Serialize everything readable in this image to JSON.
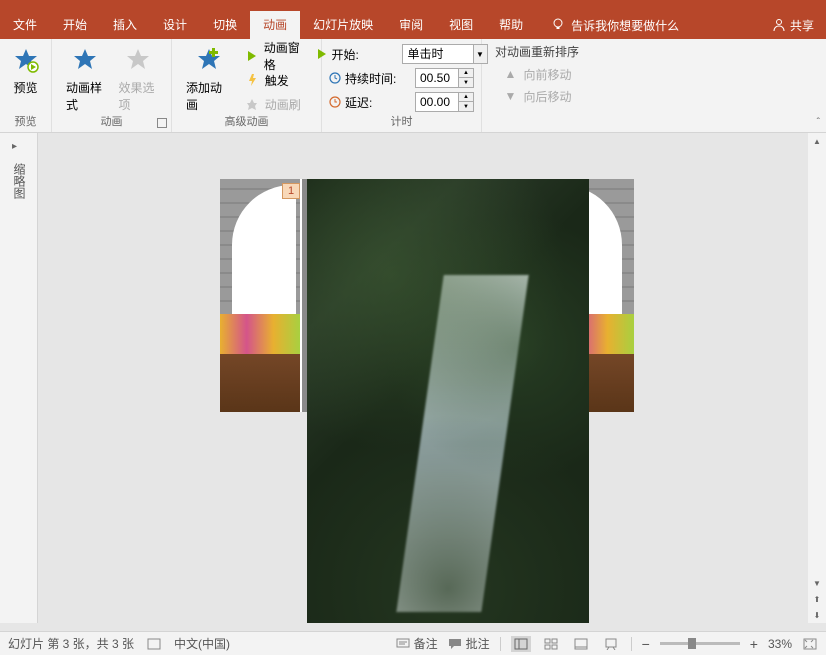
{
  "tabs": {
    "file": "文件",
    "home": "开始",
    "insert": "插入",
    "design": "设计",
    "transitions": "切换",
    "animations": "动画",
    "slideshow": "幻灯片放映",
    "review": "审阅",
    "view": "视图",
    "help": "帮助"
  },
  "tell_me": "告诉我你想要做什么",
  "share": "共享",
  "ribbon": {
    "preview": {
      "btn": "预览",
      "group": "预览"
    },
    "animation": {
      "styles": "动画样式",
      "options": "效果选项",
      "group": "动画"
    },
    "advanced": {
      "add": "添加动画",
      "pane": "动画窗格",
      "trigger": "触发",
      "painter": "动画刷",
      "group": "高级动画"
    },
    "timing": {
      "start_lbl": "开始:",
      "start_val": "单击时",
      "duration_lbl": "持续时间:",
      "duration_val": "00.50",
      "delay_lbl": "延迟:",
      "delay_val": "00.00",
      "group": "计时"
    },
    "reorder": {
      "title": "对动画重新排序",
      "earlier": "向前移动",
      "later": "向后移动"
    }
  },
  "panel_label": "缩略图",
  "anim_tag": "1",
  "status": {
    "slide": "幻灯片 第 3 张，共 3 张",
    "lang": "中文(中国)",
    "notes": "备注",
    "comments": "批注",
    "zoom": "33%"
  }
}
